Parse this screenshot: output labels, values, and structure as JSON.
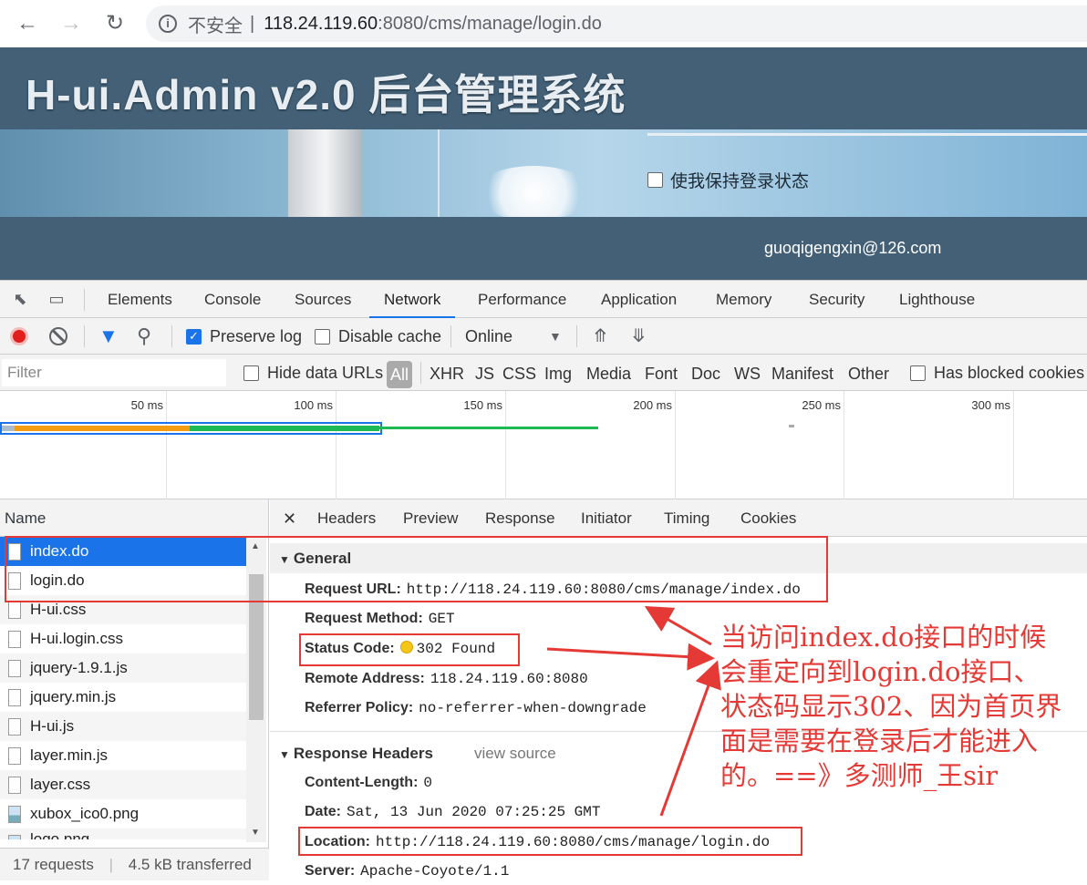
{
  "browser": {
    "security_label": "不安全",
    "url_host": "118.24.119.60",
    "url_path": ":8080/cms/manage/login.do",
    "back_icon": "back-arrow-icon",
    "forward_icon": "forward-arrow-icon",
    "reload_icon": "reload-icon"
  },
  "page": {
    "title": "H-ui.Admin v2.0 后台管理系统",
    "remember_label": "使我保持登录状态",
    "footer_email": "guoqigengxin@126.com"
  },
  "devtools": {
    "tabs": [
      "Elements",
      "Console",
      "Sources",
      "Network",
      "Performance",
      "Application",
      "Memory",
      "Security",
      "Lighthouse"
    ],
    "active_tab": "Network",
    "toolbar": {
      "preserve_log": "Preserve log",
      "disable_cache": "Disable cache",
      "throttle": "Online"
    },
    "filter": {
      "placeholder": "Filter",
      "hide_data_urls": "Hide data URLs",
      "types": [
        "All",
        "XHR",
        "JS",
        "CSS",
        "Img",
        "Media",
        "Font",
        "Doc",
        "WS",
        "Manifest",
        "Other"
      ],
      "has_blocked_cookies": "Has blocked cookies"
    },
    "timeline": {
      "ticks": [
        "50 ms",
        "100 ms",
        "150 ms",
        "200 ms",
        "250 ms",
        "300 ms"
      ]
    },
    "requests": {
      "header": "Name",
      "items": [
        "index.do",
        "login.do",
        "H-ui.css",
        "H-ui.login.css",
        "jquery-1.9.1.js",
        "jquery.min.js",
        "H-ui.js",
        "layer.min.js",
        "layer.css",
        "xubox_ico0.png",
        "logo.png"
      ],
      "status_requests": "17 requests",
      "status_transferred": "4.5 kB transferred"
    },
    "detail": {
      "tabs": [
        "Headers",
        "Preview",
        "Response",
        "Initiator",
        "Timing",
        "Cookies"
      ],
      "general_title": "General",
      "request_url_key": "Request URL:",
      "request_url": "http://118.24.119.60:8080/cms/manage/index.do",
      "request_method_key": "Request Method:",
      "request_method": "GET",
      "status_code_key": "Status Code:",
      "status_code": "302 Found",
      "remote_address_key": "Remote Address:",
      "remote_address": "118.24.119.60:8080",
      "referrer_policy_key": "Referrer Policy:",
      "referrer_policy": "no-referrer-when-downgrade",
      "response_headers_title": "Response Headers",
      "view_source": "view source",
      "content_length_key": "Content-Length:",
      "content_length": "0",
      "date_key": "Date:",
      "date": "Sat, 13 Jun 2020 07:25:25 GMT",
      "location_key": "Location:",
      "location": "http://118.24.119.60:8080/cms/manage/login.do",
      "server_key": "Server:",
      "server": "Apache-Coyote/1.1"
    }
  },
  "annotation": {
    "lines": [
      "当访问index.do接口的时候",
      "会重定向到login.do接口、",
      "状态码显示302、因为首页界",
      "面是需要在登录后才能进入",
      "的。==》多测师_王sir"
    ],
    "color": "#e53935"
  }
}
